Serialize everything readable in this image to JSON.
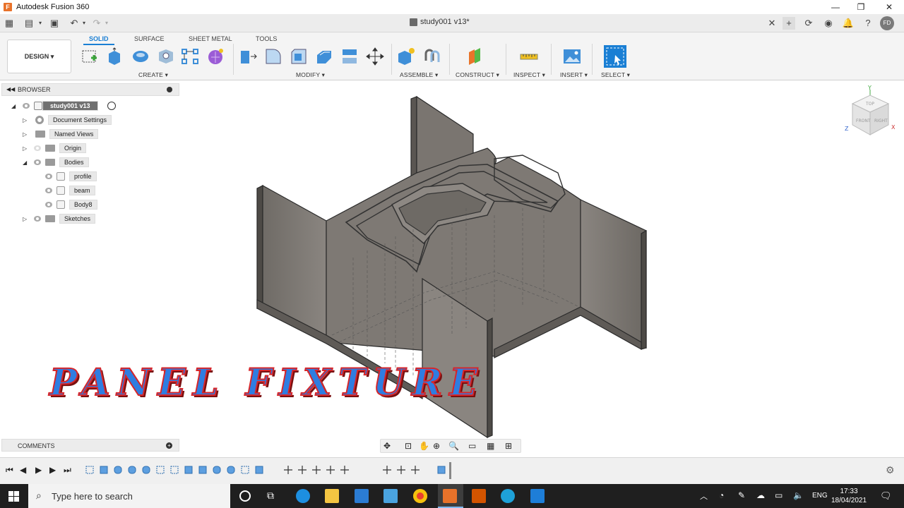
{
  "app": {
    "title": "Autodesk Fusion 360",
    "logo_letter": "F",
    "document_tab": "study001 v13*",
    "user_initials": "FD"
  },
  "ribbon": {
    "tabs": [
      "SOLID",
      "SURFACE",
      "SHEET METAL",
      "TOOLS"
    ],
    "active_tab": "SOLID",
    "workspace_button": "DESIGN ▾",
    "groups": [
      "CREATE ▾",
      "MODIFY ▾",
      "ASSEMBLE ▾",
      "CONSTRUCT ▾",
      "INSPECT ▾",
      "INSERT ▾",
      "SELECT ▾"
    ]
  },
  "browser": {
    "title": "BROWSER",
    "root": "study001 v13",
    "items": [
      {
        "label": "Document Settings"
      },
      {
        "label": "Named Views"
      },
      {
        "label": "Origin"
      },
      {
        "label": "Bodies"
      },
      {
        "label": "profile"
      },
      {
        "label": "beam"
      },
      {
        "label": "Body8"
      },
      {
        "label": "Sketches"
      }
    ]
  },
  "comments": {
    "title": "COMMENTS"
  },
  "viewcube": {
    "top": "TOP",
    "front": "FRONT",
    "right": "RIGHT",
    "axis_y": "Y",
    "axis_x": "X",
    "axis_z": "Z"
  },
  "overlay": {
    "banner": "PANEL FIXTURE"
  },
  "taskbar": {
    "search_placeholder": "Type here to search",
    "language": "ENG",
    "time": "17:33",
    "date": "18/04/2021"
  }
}
